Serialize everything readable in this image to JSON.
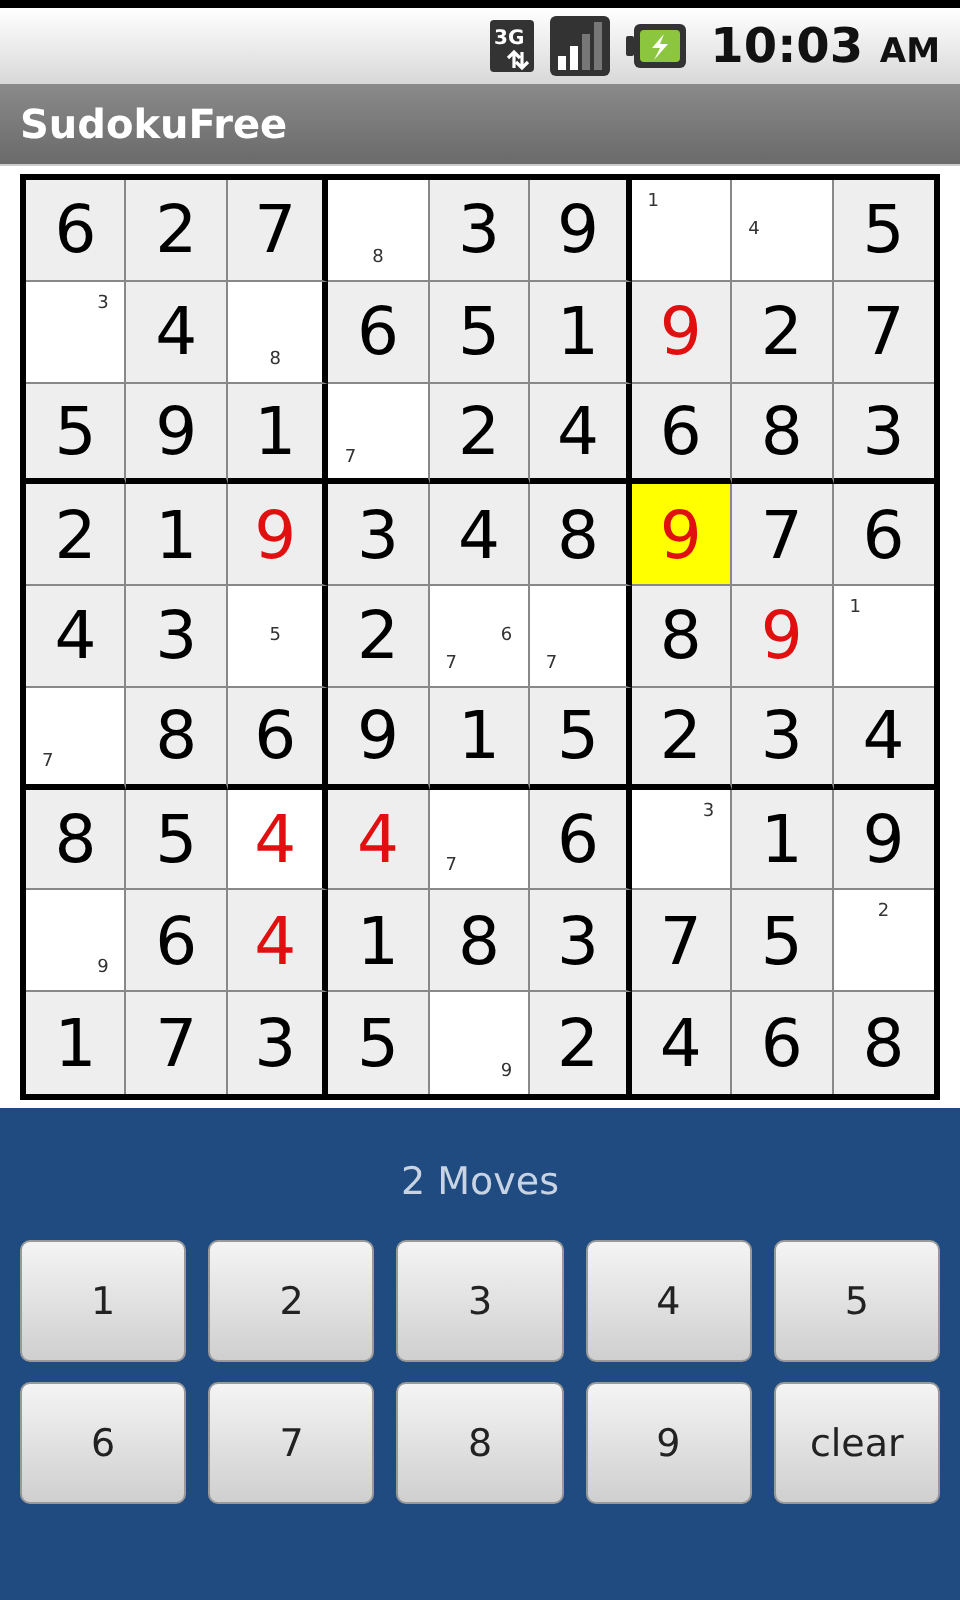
{
  "status_bar": {
    "time": "10:03",
    "meridiem": "AM",
    "network": "3G"
  },
  "app_bar": {
    "title": "SudokuFree"
  },
  "grid": {
    "rows": [
      [
        {
          "value": "6",
          "shaded": true,
          "error": false,
          "selected": false
        },
        {
          "value": "2",
          "shaded": true,
          "error": false,
          "selected": false
        },
        {
          "value": "7",
          "shaded": true,
          "error": false,
          "selected": false
        },
        {
          "notes": [
            "8"
          ],
          "shaded": false,
          "selected": false
        },
        {
          "value": "3",
          "shaded": true,
          "error": false,
          "selected": false
        },
        {
          "value": "9",
          "shaded": true,
          "error": false,
          "selected": false
        },
        {
          "notes": [
            "1"
          ],
          "shaded": false,
          "selected": false
        },
        {
          "notes": [
            "4"
          ],
          "shaded": false,
          "selected": false
        },
        {
          "value": "5",
          "shaded": true,
          "error": false,
          "selected": false
        }
      ],
      [
        {
          "notes": [
            "3"
          ],
          "shaded": false,
          "selected": false
        },
        {
          "value": "4",
          "shaded": true,
          "error": false,
          "selected": false
        },
        {
          "notes": [
            "8"
          ],
          "shaded": false,
          "selected": false
        },
        {
          "value": "6",
          "shaded": true,
          "error": false,
          "selected": false
        },
        {
          "value": "5",
          "shaded": true,
          "error": false,
          "selected": false
        },
        {
          "value": "1",
          "shaded": true,
          "error": false,
          "selected": false
        },
        {
          "value": "9",
          "shaded": true,
          "error": true,
          "selected": false
        },
        {
          "value": "2",
          "shaded": true,
          "error": false,
          "selected": false
        },
        {
          "value": "7",
          "shaded": true,
          "error": false,
          "selected": false
        }
      ],
      [
        {
          "value": "5",
          "shaded": true,
          "error": false,
          "selected": false
        },
        {
          "value": "9",
          "shaded": true,
          "error": false,
          "selected": false
        },
        {
          "value": "1",
          "shaded": true,
          "error": false,
          "selected": false
        },
        {
          "notes": [
            "7"
          ],
          "shaded": false,
          "selected": false
        },
        {
          "value": "2",
          "shaded": true,
          "error": false,
          "selected": false
        },
        {
          "value": "4",
          "shaded": true,
          "error": false,
          "selected": false
        },
        {
          "value": "6",
          "shaded": true,
          "error": false,
          "selected": false
        },
        {
          "value": "8",
          "shaded": true,
          "error": false,
          "selected": false
        },
        {
          "value": "3",
          "shaded": true,
          "error": false,
          "selected": false
        }
      ],
      [
        {
          "value": "2",
          "shaded": true,
          "error": false,
          "selected": false
        },
        {
          "value": "1",
          "shaded": true,
          "error": false,
          "selected": false
        },
        {
          "value": "9",
          "shaded": true,
          "error": true,
          "selected": false
        },
        {
          "value": "3",
          "shaded": true,
          "error": false,
          "selected": false
        },
        {
          "value": "4",
          "shaded": true,
          "error": false,
          "selected": false
        },
        {
          "value": "8",
          "shaded": true,
          "error": false,
          "selected": false
        },
        {
          "value": "9",
          "shaded": true,
          "error": true,
          "selected": true
        },
        {
          "value": "7",
          "shaded": true,
          "error": false,
          "selected": false
        },
        {
          "value": "6",
          "shaded": true,
          "error": false,
          "selected": false
        }
      ],
      [
        {
          "value": "4",
          "shaded": true,
          "error": false,
          "selected": false
        },
        {
          "value": "3",
          "shaded": true,
          "error": false,
          "selected": false
        },
        {
          "notes": [
            "5"
          ],
          "shaded": false,
          "selected": false
        },
        {
          "value": "2",
          "shaded": true,
          "error": false,
          "selected": false
        },
        {
          "notes": [
            "7",
            "6"
          ],
          "shaded": false,
          "selected": false
        },
        {
          "notes": [
            "7"
          ],
          "shaded": false,
          "selected": false
        },
        {
          "value": "8",
          "shaded": true,
          "error": false,
          "selected": false
        },
        {
          "value": "9",
          "shaded": true,
          "error": true,
          "selected": false
        },
        {
          "notes": [
            "1"
          ],
          "shaded": false,
          "selected": false
        }
      ],
      [
        {
          "notes": [
            "7"
          ],
          "shaded": false,
          "selected": false
        },
        {
          "value": "8",
          "shaded": true,
          "error": false,
          "selected": false
        },
        {
          "value": "6",
          "shaded": true,
          "error": false,
          "selected": false
        },
        {
          "value": "9",
          "shaded": true,
          "error": false,
          "selected": false
        },
        {
          "value": "1",
          "shaded": true,
          "error": false,
          "selected": false
        },
        {
          "value": "5",
          "shaded": true,
          "error": false,
          "selected": false
        },
        {
          "value": "2",
          "shaded": true,
          "error": false,
          "selected": false
        },
        {
          "value": "3",
          "shaded": true,
          "error": false,
          "selected": false
        },
        {
          "value": "4",
          "shaded": true,
          "error": false,
          "selected": false
        }
      ],
      [
        {
          "value": "8",
          "shaded": true,
          "error": false,
          "selected": false
        },
        {
          "value": "5",
          "shaded": true,
          "error": false,
          "selected": false
        },
        {
          "value": "4",
          "shaded": false,
          "error": true,
          "selected": false
        },
        {
          "value": "4",
          "shaded": true,
          "error": true,
          "selected": false
        },
        {
          "notes": [
            "7"
          ],
          "shaded": false,
          "selected": false
        },
        {
          "value": "6",
          "shaded": true,
          "error": false,
          "selected": false
        },
        {
          "notes": [
            "3"
          ],
          "shaded": false,
          "selected": false
        },
        {
          "value": "1",
          "shaded": true,
          "error": false,
          "selected": false
        },
        {
          "value": "9",
          "shaded": true,
          "error": false,
          "selected": false
        }
      ],
      [
        {
          "notes": [
            "9"
          ],
          "shaded": false,
          "selected": false
        },
        {
          "value": "6",
          "shaded": true,
          "error": false,
          "selected": false
        },
        {
          "value": "4",
          "shaded": true,
          "error": true,
          "selected": false
        },
        {
          "value": "1",
          "shaded": true,
          "error": false,
          "selected": false
        },
        {
          "value": "8",
          "shaded": true,
          "error": false,
          "selected": false
        },
        {
          "value": "3",
          "shaded": true,
          "error": false,
          "selected": false
        },
        {
          "value": "7",
          "shaded": true,
          "error": false,
          "selected": false
        },
        {
          "value": "5",
          "shaded": true,
          "error": false,
          "selected": false
        },
        {
          "notes": [
            "2"
          ],
          "shaded": false,
          "selected": false
        }
      ],
      [
        {
          "value": "1",
          "shaded": true,
          "error": false,
          "selected": false
        },
        {
          "value": "7",
          "shaded": true,
          "error": false,
          "selected": false
        },
        {
          "value": "3",
          "shaded": true,
          "error": false,
          "selected": false
        },
        {
          "value": "5",
          "shaded": true,
          "error": false,
          "selected": false
        },
        {
          "notes": [
            "9"
          ],
          "shaded": false,
          "selected": false
        },
        {
          "value": "2",
          "shaded": true,
          "error": false,
          "selected": false
        },
        {
          "value": "4",
          "shaded": true,
          "error": false,
          "selected": false
        },
        {
          "value": "6",
          "shaded": true,
          "error": false,
          "selected": false
        },
        {
          "value": "8",
          "shaded": true,
          "error": false,
          "selected": false
        }
      ]
    ]
  },
  "moves": "2 Moves",
  "keypad": [
    "1",
    "2",
    "3",
    "4",
    "5",
    "6",
    "7",
    "8",
    "9",
    "clear"
  ]
}
